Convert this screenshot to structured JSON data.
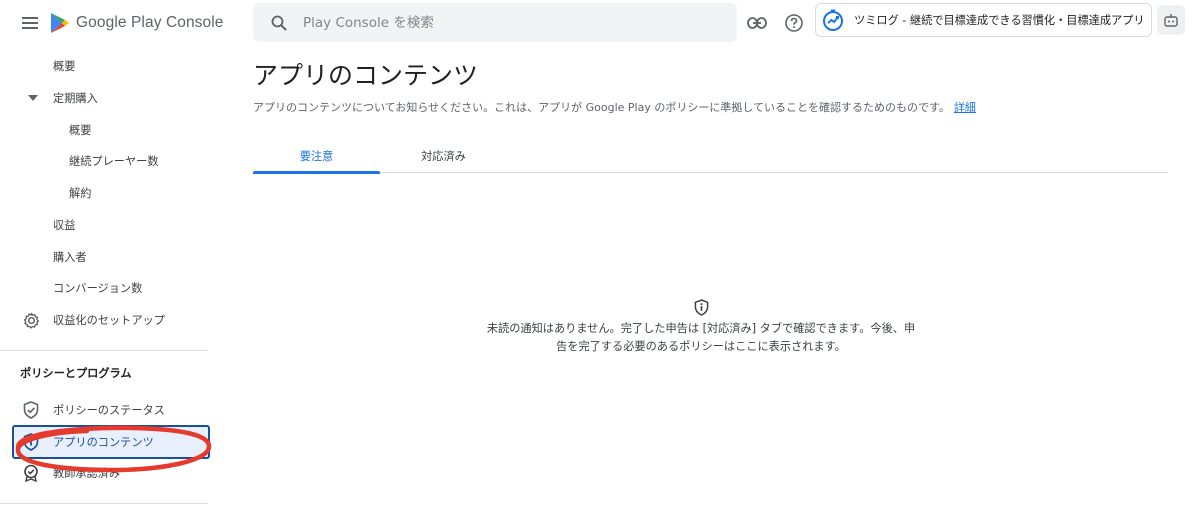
{
  "topbar": {
    "logo_text": "Google Play Console",
    "search_placeholder": "Play Console を検索",
    "app_name": "ツミログ - 継続で目標達成できる習慣化・目標達成アプリ"
  },
  "sidebar": {
    "items": [
      {
        "label": "概要"
      },
      {
        "label": "定期購入"
      },
      {
        "label": "概要"
      },
      {
        "label": "継続プレーヤー数"
      },
      {
        "label": "解約"
      },
      {
        "label": "収益"
      },
      {
        "label": "購入者"
      },
      {
        "label": "コンバージョン数"
      },
      {
        "label": "収益化のセットアップ"
      }
    ],
    "section_title": "ポリシーとプログラム",
    "policy_items": [
      {
        "label": "ポリシーのステータス"
      },
      {
        "label": "アプリのコンテンツ"
      },
      {
        "label": "教師承認済み"
      }
    ]
  },
  "main": {
    "title": "アプリのコンテンツ",
    "description": "アプリのコンテンツについてお知らせください。これは、アプリが Google Play のポリシーに準拠していることを確認するためのものです。",
    "learn_more": "詳細",
    "tabs": [
      {
        "label": "要注意",
        "active": true
      },
      {
        "label": "対応済み",
        "active": false
      }
    ],
    "empty_line1": "未読の通知はありません。完了した申告は [対応済み] タブで確認できます。今後、申",
    "empty_line2": "告を完了する必要のあるポリシーはここに表示されます。"
  },
  "colors": {
    "accent": "#1a73e8",
    "selected_bg": "#e8f0fe",
    "annotation": "#e53b2c"
  }
}
